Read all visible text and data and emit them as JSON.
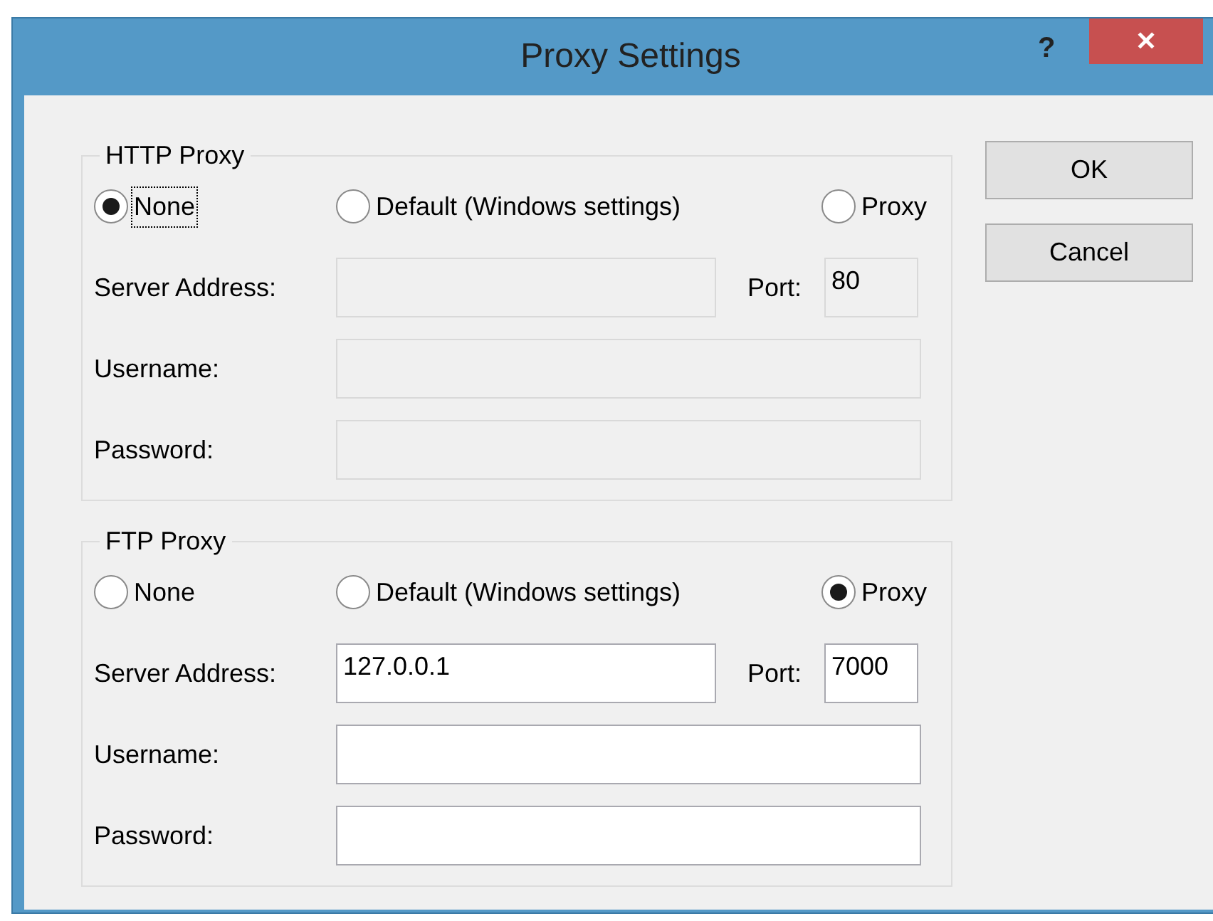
{
  "window": {
    "title": "Proxy Settings",
    "help": "?",
    "close": "✕"
  },
  "groups": [
    {
      "title": "HTTP Proxy",
      "options": [
        {
          "label": "None",
          "selected": true,
          "focused": true
        },
        {
          "label": "Default (Windows settings)",
          "selected": false,
          "focused": false
        },
        {
          "label": "Proxy",
          "selected": false,
          "focused": false
        }
      ],
      "server_label": "Server Address:",
      "port_label": "Port:",
      "port_value": "80",
      "username_label": "Username:",
      "password_label": "Password:",
      "disabled": true
    },
    {
      "title": "FTP Proxy",
      "options": [
        {
          "label": "None",
          "selected": false,
          "focused": false
        },
        {
          "label": "Default (Windows settings)",
          "selected": false,
          "focused": false
        },
        {
          "label": "Proxy",
          "selected": true,
          "focused": false
        }
      ],
      "server_label": "Server Address:",
      "server_value": "127.0.0.1",
      "port_label": "Port:",
      "port_value": "7000",
      "username_label": "Username:",
      "password_label": "Password:",
      "disabled": false
    }
  ],
  "buttons": [
    "OK",
    "Cancel"
  ]
}
